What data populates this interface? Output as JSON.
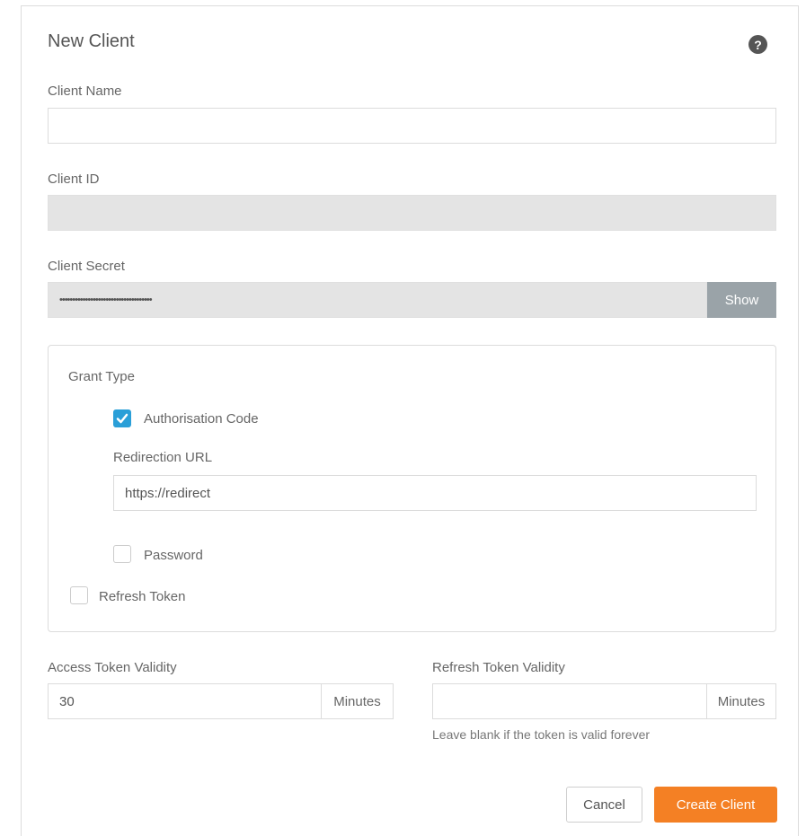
{
  "dialog": {
    "title": "New Client",
    "help_icon": "question-circle-icon"
  },
  "client_name": {
    "label": "Client Name",
    "value": "",
    "placeholder": ""
  },
  "client_id": {
    "label": "Client ID",
    "value": ""
  },
  "client_secret": {
    "label": "Client Secret",
    "value": "••••••••••••••••••••••••••••••••••••",
    "show_label": "Show"
  },
  "grant_type": {
    "label": "Grant Type",
    "authorisation_code": {
      "label": "Authorisation Code",
      "checked": true
    },
    "redirection_url": {
      "label": "Redirection URL",
      "value": "https://redirect"
    },
    "password": {
      "label": "Password",
      "checked": false
    },
    "refresh_token": {
      "label": "Refresh Token",
      "checked": false
    }
  },
  "access_token_validity": {
    "label": "Access Token Validity",
    "value": "30",
    "unit": "Minutes"
  },
  "refresh_token_validity": {
    "label": "Refresh Token Validity",
    "value": "",
    "unit": "Minutes",
    "hint": "Leave blank if the token is valid forever"
  },
  "actions": {
    "cancel_label": "Cancel",
    "create_label": "Create Client"
  },
  "colors": {
    "accent": "#f48024",
    "checkbox": "#2a9fd8",
    "show_button": "#9aa3a8"
  }
}
